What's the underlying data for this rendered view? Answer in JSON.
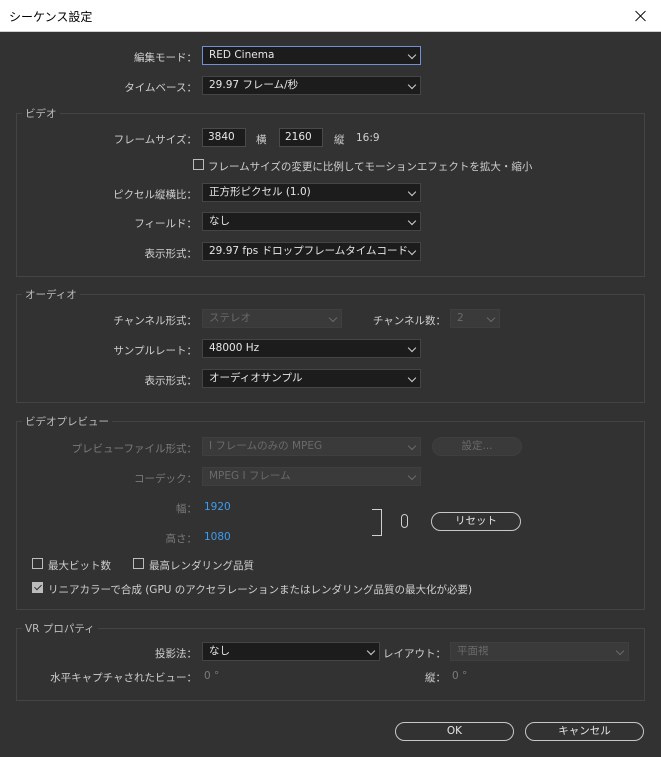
{
  "window": {
    "title": "シーケンス設定"
  },
  "general": {
    "edit_mode": {
      "label": "編集モード：",
      "value": "RED Cinema"
    },
    "timebase": {
      "label": "タイムベース：",
      "value": "29.97  フレーム/秒"
    }
  },
  "video": {
    "title": "ビデオ",
    "frame_size": {
      "label": "フレームサイズ：",
      "width": "3840",
      "width_unit": "横",
      "height": "2160",
      "height_unit": "縦",
      "aspect": "16:9"
    },
    "scale_motion_checkbox": "フレームサイズの変更に比例してモーションエフェクトを拡大・縮小",
    "pixel_aspect": {
      "label": "ピクセル縦横比：",
      "value": "正方形ピクセル (1.0)"
    },
    "field": {
      "label": "フィールド：",
      "value": "なし"
    },
    "display_format": {
      "label": "表示形式：",
      "value": "29.97  fps  ドロップフレームタイムコード"
    }
  },
  "audio": {
    "title": "オーディオ",
    "channel_format": {
      "label": "チャンネル形式：",
      "value": "ステレオ"
    },
    "channel_count": {
      "label": "チャンネル数：",
      "value": "2"
    },
    "sample_rate": {
      "label": "サンプルレート：",
      "value": "48000 Hz"
    },
    "display_format": {
      "label": "表示形式：",
      "value": "オーディオサンプル"
    }
  },
  "preview": {
    "title": "ビデオプレビュー",
    "file_format": {
      "label": "プレビューファイル形式：",
      "value": "I フレームのみの MPEG"
    },
    "settings_button": "設定...",
    "codec": {
      "label": "コーデック：",
      "value": "MPEG I フレーム"
    },
    "width": {
      "label": "幅：",
      "value": "1920"
    },
    "height": {
      "label": "高さ：",
      "value": "1080"
    },
    "reset_button": "リセット",
    "max_bit_depth": "最大ビット数",
    "max_render_quality": "最高レンダリング品質",
    "linear_color": "リニアカラーで合成 (GPU のアクセラレーションまたはレンダリング品質の最大化が必要)"
  },
  "vr": {
    "title": "VR プロパティ",
    "projection": {
      "label": "投影法：",
      "value": "なし"
    },
    "layout": {
      "label": "レイアウト：",
      "value": "平面視"
    },
    "horizontal_view": {
      "label": "水平キャプチャされたビュー：",
      "value": "0 °"
    },
    "vertical": {
      "label": "縦：",
      "value": "0 °"
    }
  },
  "buttons": {
    "ok": "OK",
    "cancel": "キャンセル"
  }
}
